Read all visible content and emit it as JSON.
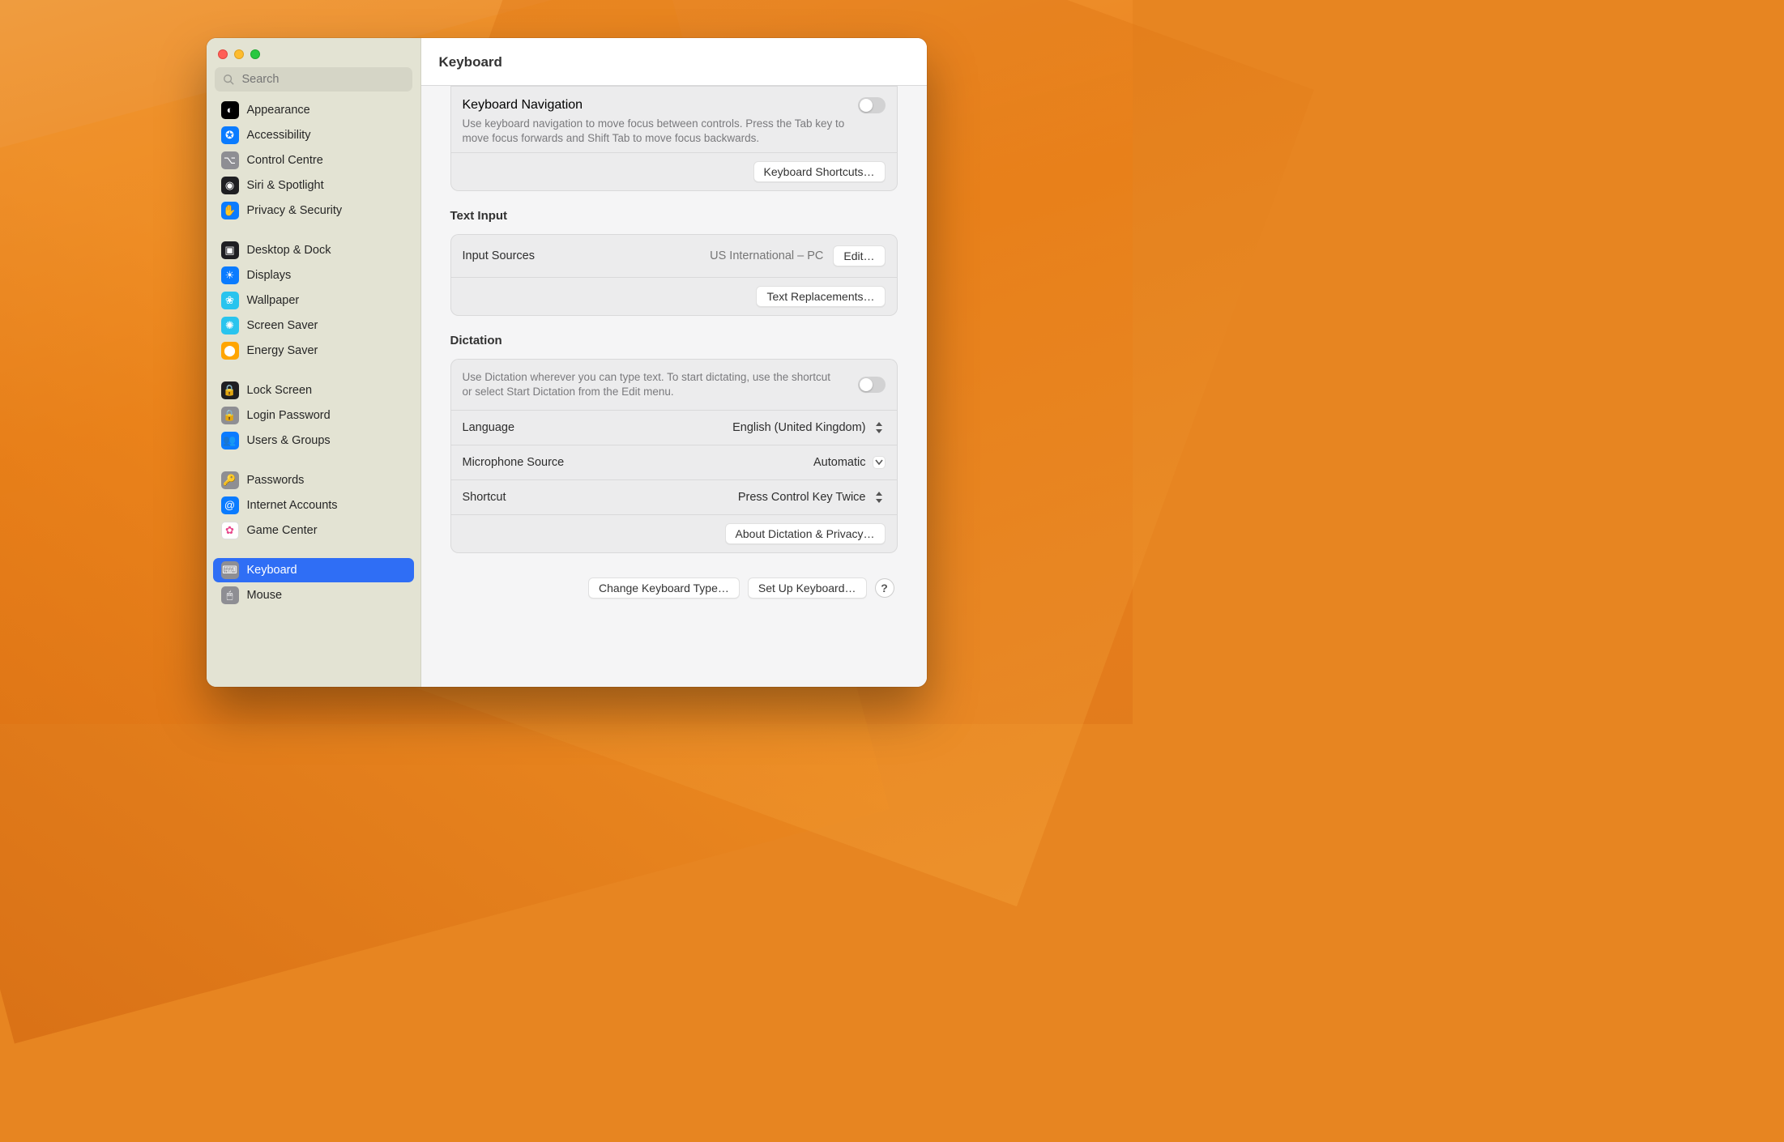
{
  "search_placeholder": "Search",
  "header_title": "Keyboard",
  "sidebar": {
    "items": [
      {
        "label": "Appearance",
        "color": "#000000",
        "glyph": "◐"
      },
      {
        "label": "Accessibility",
        "color": "#0a7bff",
        "glyph": "✪"
      },
      {
        "label": "Control Centre",
        "color": "#8e8e93",
        "glyph": "⌥"
      },
      {
        "label": "Siri & Spotlight",
        "color": "#1f1f22",
        "glyph": "◉"
      },
      {
        "label": "Privacy & Security",
        "color": "#0a7bff",
        "glyph": "✋"
      },
      {
        "gap": true
      },
      {
        "label": "Desktop & Dock",
        "color": "#1f1f22",
        "glyph": "▣"
      },
      {
        "label": "Displays",
        "color": "#0a7bff",
        "glyph": "☀"
      },
      {
        "label": "Wallpaper",
        "color": "#29c4ee",
        "glyph": "❀"
      },
      {
        "label": "Screen Saver",
        "color": "#29c4ee",
        "glyph": "✺"
      },
      {
        "label": "Energy Saver",
        "color": "#ffa500",
        "glyph": "⬤"
      },
      {
        "gap": true
      },
      {
        "label": "Lock Screen",
        "color": "#1f1f22",
        "glyph": "🔒"
      },
      {
        "label": "Login Password",
        "color": "#8e8e93",
        "glyph": "🔒"
      },
      {
        "label": "Users & Groups",
        "color": "#0a7bff",
        "glyph": "👥"
      },
      {
        "gap": true
      },
      {
        "label": "Passwords",
        "color": "#8e8e93",
        "glyph": "🔑"
      },
      {
        "label": "Internet Accounts",
        "color": "#0a7bff",
        "glyph": "@"
      },
      {
        "label": "Game Center",
        "color": "#ffffffcc",
        "glyph": "✿",
        "textglyph": true
      },
      {
        "gap": true
      },
      {
        "label": "Keyboard",
        "color": "#8e8e93",
        "glyph": "⌨",
        "selected": true
      },
      {
        "label": "Mouse",
        "color": "#8e8e93",
        "glyph": "🖱"
      }
    ]
  },
  "keyboard_nav": {
    "title": "Keyboard Navigation",
    "desc": "Use keyboard navigation to move focus between controls. Press the Tab key to move focus forwards and Shift Tab to move focus backwards.",
    "shortcuts_btn": "Keyboard Shortcuts…",
    "toggle_on": false
  },
  "text_input": {
    "section_title": "Text Input",
    "input_sources_label": "Input Sources",
    "input_sources_value": "US International – PC",
    "edit_btn": "Edit…",
    "text_replace_btn": "Text Replacements…"
  },
  "dictation": {
    "section_title": "Dictation",
    "desc": "Use Dictation wherever you can type text. To start dictating, use the shortcut or select Start Dictation from the Edit menu.",
    "toggle_on": false,
    "language_label": "Language",
    "language_value": "English (United Kingdom)",
    "mic_label": "Microphone Source",
    "mic_value": "Automatic",
    "shortcut_label": "Shortcut",
    "shortcut_value": "Press Control Key Twice",
    "about_btn": "About Dictation & Privacy…"
  },
  "footer": {
    "change_kbd_type": "Change Keyboard Type…",
    "setup_kbd": "Set Up Keyboard…",
    "help": "?"
  }
}
